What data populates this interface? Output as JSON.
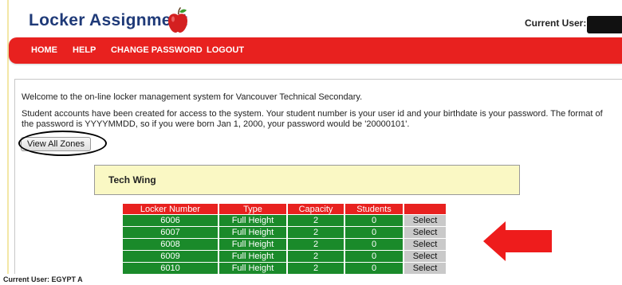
{
  "header": {
    "title": "Locker Assignment",
    "logo_icon": "apple-icon",
    "current_user_label": "Current User:"
  },
  "nav": {
    "items": [
      "HOME",
      "HELP",
      "CHANGE PASSWORD",
      "LOGOUT"
    ]
  },
  "content": {
    "welcome": "Welcome to the on-line locker management system for Vancouver Technical Secondary.",
    "info": "Student accounts have been created for access to the system. Your student number is your user id and your birthdate is your password. The format of the password is YYYYMMDD, so if you were born Jan 1, 2000, your password would be '20000101'.",
    "view_all_label": "View All Zones"
  },
  "zone": {
    "title": "Tech Wing"
  },
  "table": {
    "headers": [
      "Locker Number",
      "Type",
      "Capacity",
      "Students",
      ""
    ],
    "rows": [
      [
        "6006",
        "Full Height",
        "2",
        "0",
        "Select"
      ],
      [
        "6007",
        "Full Height",
        "2",
        "0",
        "Select"
      ],
      [
        "6008",
        "Full Height",
        "2",
        "0",
        "Select"
      ],
      [
        "6009",
        "Full Height",
        "2",
        "0",
        "Select"
      ],
      [
        "6010",
        "Full Height",
        "2",
        "0",
        "Select"
      ]
    ]
  },
  "footer": {
    "current_user": "Current User: EGYPT A"
  },
  "colors": {
    "brand_blue": "#1f3a78",
    "nav_red": "#e8211f",
    "row_green": "#1a8a2a",
    "zone_yellow": "#faf8c4"
  }
}
